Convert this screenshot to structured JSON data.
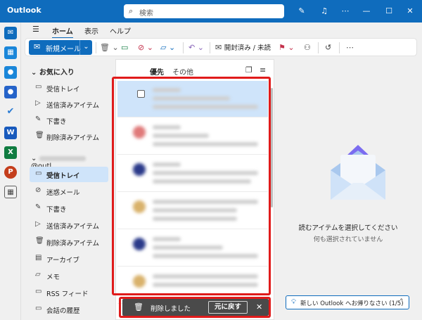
{
  "titlebar": {
    "app_name": "Outlook",
    "search_placeholder": "検索"
  },
  "ribbon": {
    "tabs": [
      "ホーム",
      "表示",
      "ヘルプ"
    ],
    "active_tab": "ホーム",
    "new_mail_label": "新規メール",
    "mark_read_label": "開封済み / 未読"
  },
  "folders": {
    "favorites_header": "お気に入り",
    "favorites": [
      {
        "label": "受信トレイ",
        "icon": "inbox-icon"
      },
      {
        "label": "送信済みアイテム",
        "icon": "send-icon"
      },
      {
        "label": "下書き",
        "icon": "pencil-icon"
      },
      {
        "label": "削除済みアイテム",
        "icon": "trash-icon"
      }
    ],
    "account_suffix": "@outl...",
    "account_items": [
      {
        "label": "受信トレイ",
        "icon": "inbox-icon",
        "selected": true
      },
      {
        "label": "迷惑メール",
        "icon": "junk-icon"
      },
      {
        "label": "下書き",
        "icon": "pencil-icon"
      },
      {
        "label": "送信済みアイテム",
        "icon": "send-icon"
      },
      {
        "label": "削除済みアイテム",
        "icon": "trash-icon"
      },
      {
        "label": "アーカイブ",
        "icon": "archive-icon"
      },
      {
        "label": "メモ",
        "icon": "note-icon"
      },
      {
        "label": "RSS フィード",
        "icon": "folder-icon"
      },
      {
        "label": "会話の履歴",
        "icon": "folder-icon"
      }
    ]
  },
  "message_list": {
    "tab_focused": "優先",
    "tab_other": "その他"
  },
  "toast": {
    "message": "削除しました",
    "undo_label": "元に戻す"
  },
  "reading_pane": {
    "title": "読むアイテムを選択してください",
    "subtitle": "何も選択されていません",
    "banner": "新しい Outlook へお帰りなさい (1/5)"
  },
  "colors": {
    "accent": "#0f6cbd",
    "highlight_box": "#e01b1b",
    "selected_bg": "#cfe4fa",
    "toast_bg": "#4a4a4a"
  }
}
